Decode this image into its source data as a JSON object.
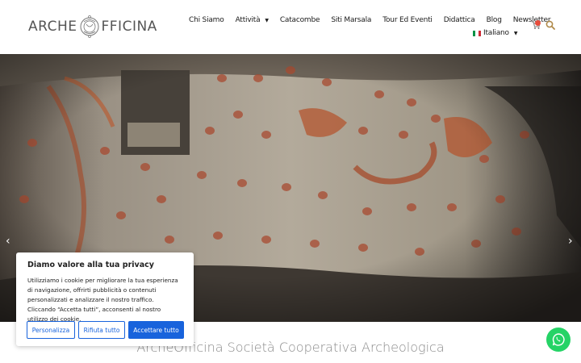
{
  "header": {
    "logo_left": "ARCHE",
    "logo_right": "FFICINA",
    "nav": [
      {
        "label": "Chi Siamo",
        "caret": false
      },
      {
        "label": "Attività",
        "caret": true
      },
      {
        "label": "Catacombe",
        "caret": false
      },
      {
        "label": "Siti Marsala",
        "caret": false
      },
      {
        "label": "Tour Ed Eventi",
        "caret": false
      },
      {
        "label": "Didattica",
        "caret": false
      },
      {
        "label": "Blog",
        "caret": false
      },
      {
        "label": "Newsletter",
        "caret": false
      }
    ],
    "language": "Italiano",
    "icons": [
      "cart-icon",
      "search-icon"
    ]
  },
  "hero": {
    "prev_arrow": "‹",
    "next_arrow": "›"
  },
  "subtitle": "ArcheOfficina Società Cooperativa Archeologica",
  "cookie": {
    "title": "Diamo valore alla tua privacy",
    "text": "Utilizziamo i cookie per migliorare la tua esperienza di navigazione, offrirti pubblicità o contenuti personalizzati e analizzare il nostro traffico. Cliccando “Accetta tutti”, acconsenti al nostro utilizzo dei cookie.",
    "buttons": {
      "customize": "Personalizza",
      "reject": "Rifiuta tutto",
      "accept": "Accettare tutto"
    }
  },
  "colors": {
    "accent": "#1863dc",
    "whatsapp": "#25d366",
    "badge": "#e74c3c"
  }
}
